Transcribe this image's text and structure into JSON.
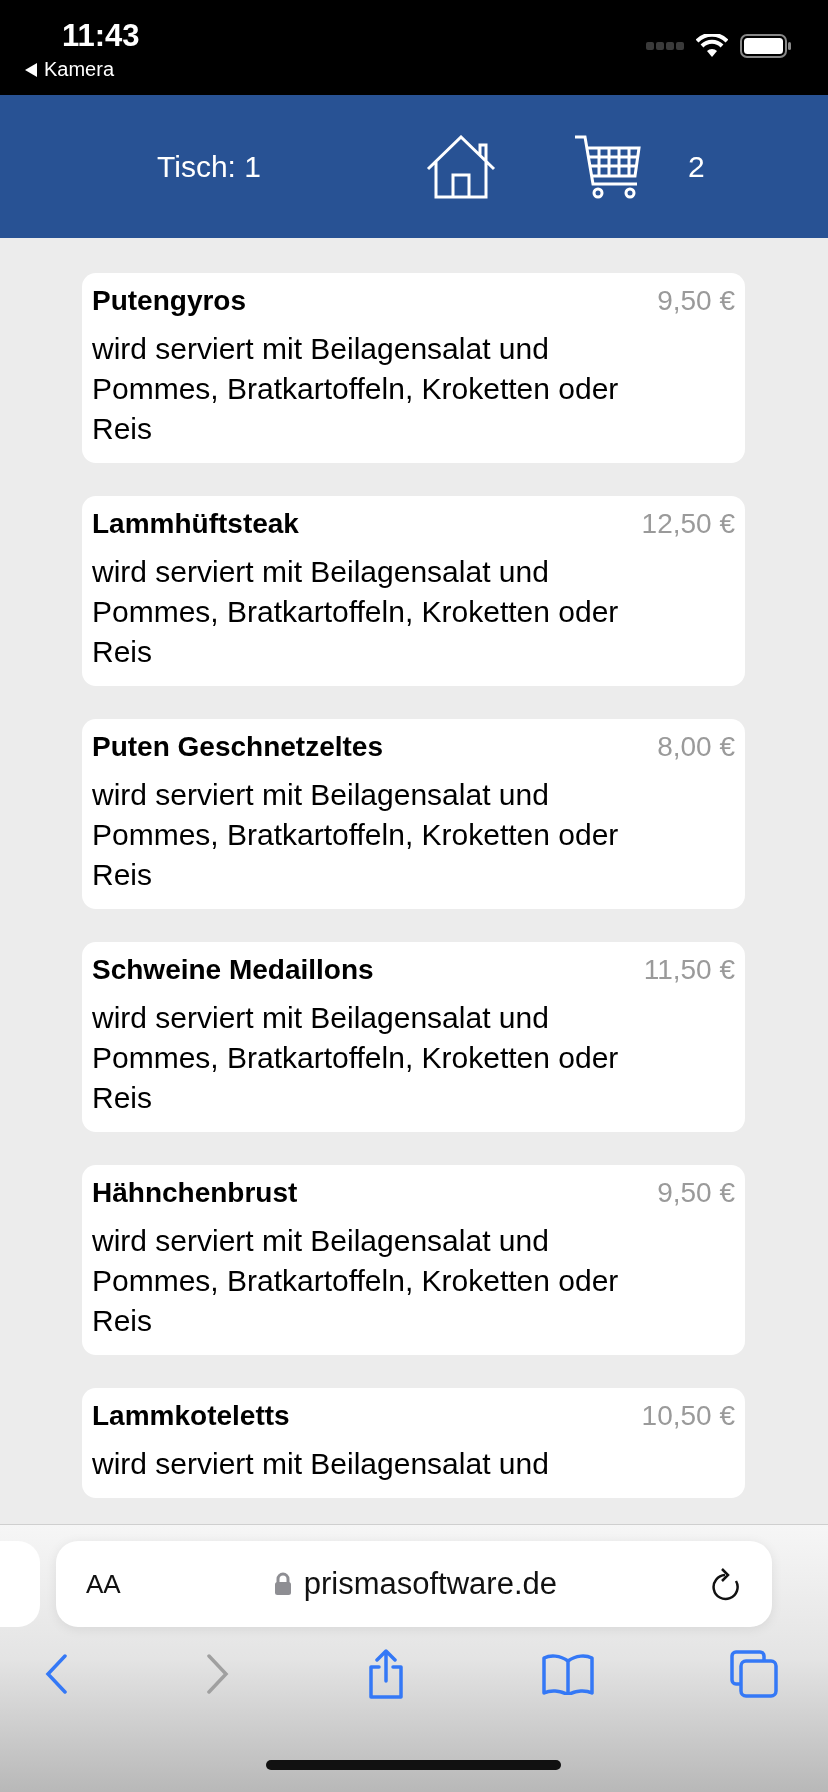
{
  "status_bar": {
    "time": "11:43",
    "back_app": "Kamera"
  },
  "header": {
    "table_label": "Tisch: 1",
    "cart_count": "2"
  },
  "menu_items": [
    {
      "name": "Putengyros",
      "price": "9,50 €",
      "description": "wird serviert mit Beilagensalat und Pommes, Bratkartoffeln, Kroketten oder Reis"
    },
    {
      "name": "Lammhüftsteak",
      "price": "12,50 €",
      "description": "wird serviert mit Beilagensalat und Pommes, Bratkartoffeln, Kroketten oder Reis"
    },
    {
      "name": "Puten Geschnetzeltes",
      "price": "8,00 €",
      "description": "wird serviert mit Beilagensalat und Pommes, Bratkartoffeln, Kroketten oder Reis"
    },
    {
      "name": "Schweine Medaillons",
      "price": "11,50 €",
      "description": "wird serviert mit Beilagensalat und Pommes, Bratkartoffeln, Kroketten oder Reis"
    },
    {
      "name": "Hähnchenbrust",
      "price": "9,50 €",
      "description": "wird serviert mit Beilagensalat und Pommes, Bratkartoffeln, Kroketten oder Reis"
    },
    {
      "name": "Lammkoteletts",
      "price": "10,50 €",
      "description": "wird serviert mit Beilagensalat und"
    }
  ],
  "browser": {
    "text_size_button": "AA",
    "url": "prismasoftware.de"
  }
}
